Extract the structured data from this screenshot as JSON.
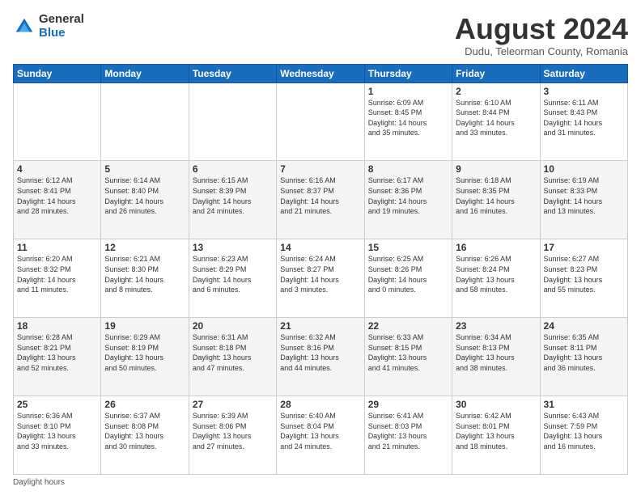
{
  "header": {
    "logo_general": "General",
    "logo_blue": "Blue",
    "month_title": "August 2024",
    "location": "Dudu, Teleorman County, Romania"
  },
  "days_of_week": [
    "Sunday",
    "Monday",
    "Tuesday",
    "Wednesday",
    "Thursday",
    "Friday",
    "Saturday"
  ],
  "weeks": [
    [
      {
        "day": "",
        "info": ""
      },
      {
        "day": "",
        "info": ""
      },
      {
        "day": "",
        "info": ""
      },
      {
        "day": "",
        "info": ""
      },
      {
        "day": "1",
        "info": "Sunrise: 6:09 AM\nSunset: 8:45 PM\nDaylight: 14 hours\nand 35 minutes."
      },
      {
        "day": "2",
        "info": "Sunrise: 6:10 AM\nSunset: 8:44 PM\nDaylight: 14 hours\nand 33 minutes."
      },
      {
        "day": "3",
        "info": "Sunrise: 6:11 AM\nSunset: 8:43 PM\nDaylight: 14 hours\nand 31 minutes."
      }
    ],
    [
      {
        "day": "4",
        "info": "Sunrise: 6:12 AM\nSunset: 8:41 PM\nDaylight: 14 hours\nand 28 minutes."
      },
      {
        "day": "5",
        "info": "Sunrise: 6:14 AM\nSunset: 8:40 PM\nDaylight: 14 hours\nand 26 minutes."
      },
      {
        "day": "6",
        "info": "Sunrise: 6:15 AM\nSunset: 8:39 PM\nDaylight: 14 hours\nand 24 minutes."
      },
      {
        "day": "7",
        "info": "Sunrise: 6:16 AM\nSunset: 8:37 PM\nDaylight: 14 hours\nand 21 minutes."
      },
      {
        "day": "8",
        "info": "Sunrise: 6:17 AM\nSunset: 8:36 PM\nDaylight: 14 hours\nand 19 minutes."
      },
      {
        "day": "9",
        "info": "Sunrise: 6:18 AM\nSunset: 8:35 PM\nDaylight: 14 hours\nand 16 minutes."
      },
      {
        "day": "10",
        "info": "Sunrise: 6:19 AM\nSunset: 8:33 PM\nDaylight: 14 hours\nand 13 minutes."
      }
    ],
    [
      {
        "day": "11",
        "info": "Sunrise: 6:20 AM\nSunset: 8:32 PM\nDaylight: 14 hours\nand 11 minutes."
      },
      {
        "day": "12",
        "info": "Sunrise: 6:21 AM\nSunset: 8:30 PM\nDaylight: 14 hours\nand 8 minutes."
      },
      {
        "day": "13",
        "info": "Sunrise: 6:23 AM\nSunset: 8:29 PM\nDaylight: 14 hours\nand 6 minutes."
      },
      {
        "day": "14",
        "info": "Sunrise: 6:24 AM\nSunset: 8:27 PM\nDaylight: 14 hours\nand 3 minutes."
      },
      {
        "day": "15",
        "info": "Sunrise: 6:25 AM\nSunset: 8:26 PM\nDaylight: 14 hours\nand 0 minutes."
      },
      {
        "day": "16",
        "info": "Sunrise: 6:26 AM\nSunset: 8:24 PM\nDaylight: 13 hours\nand 58 minutes."
      },
      {
        "day": "17",
        "info": "Sunrise: 6:27 AM\nSunset: 8:23 PM\nDaylight: 13 hours\nand 55 minutes."
      }
    ],
    [
      {
        "day": "18",
        "info": "Sunrise: 6:28 AM\nSunset: 8:21 PM\nDaylight: 13 hours\nand 52 minutes."
      },
      {
        "day": "19",
        "info": "Sunrise: 6:29 AM\nSunset: 8:19 PM\nDaylight: 13 hours\nand 50 minutes."
      },
      {
        "day": "20",
        "info": "Sunrise: 6:31 AM\nSunset: 8:18 PM\nDaylight: 13 hours\nand 47 minutes."
      },
      {
        "day": "21",
        "info": "Sunrise: 6:32 AM\nSunset: 8:16 PM\nDaylight: 13 hours\nand 44 minutes."
      },
      {
        "day": "22",
        "info": "Sunrise: 6:33 AM\nSunset: 8:15 PM\nDaylight: 13 hours\nand 41 minutes."
      },
      {
        "day": "23",
        "info": "Sunrise: 6:34 AM\nSunset: 8:13 PM\nDaylight: 13 hours\nand 38 minutes."
      },
      {
        "day": "24",
        "info": "Sunrise: 6:35 AM\nSunset: 8:11 PM\nDaylight: 13 hours\nand 36 minutes."
      }
    ],
    [
      {
        "day": "25",
        "info": "Sunrise: 6:36 AM\nSunset: 8:10 PM\nDaylight: 13 hours\nand 33 minutes."
      },
      {
        "day": "26",
        "info": "Sunrise: 6:37 AM\nSunset: 8:08 PM\nDaylight: 13 hours\nand 30 minutes."
      },
      {
        "day": "27",
        "info": "Sunrise: 6:39 AM\nSunset: 8:06 PM\nDaylight: 13 hours\nand 27 minutes."
      },
      {
        "day": "28",
        "info": "Sunrise: 6:40 AM\nSunset: 8:04 PM\nDaylight: 13 hours\nand 24 minutes."
      },
      {
        "day": "29",
        "info": "Sunrise: 6:41 AM\nSunset: 8:03 PM\nDaylight: 13 hours\nand 21 minutes."
      },
      {
        "day": "30",
        "info": "Sunrise: 6:42 AM\nSunset: 8:01 PM\nDaylight: 13 hours\nand 18 minutes."
      },
      {
        "day": "31",
        "info": "Sunrise: 6:43 AM\nSunset: 7:59 PM\nDaylight: 13 hours\nand 16 minutes."
      }
    ]
  ],
  "footer": {
    "note": "Daylight hours"
  }
}
